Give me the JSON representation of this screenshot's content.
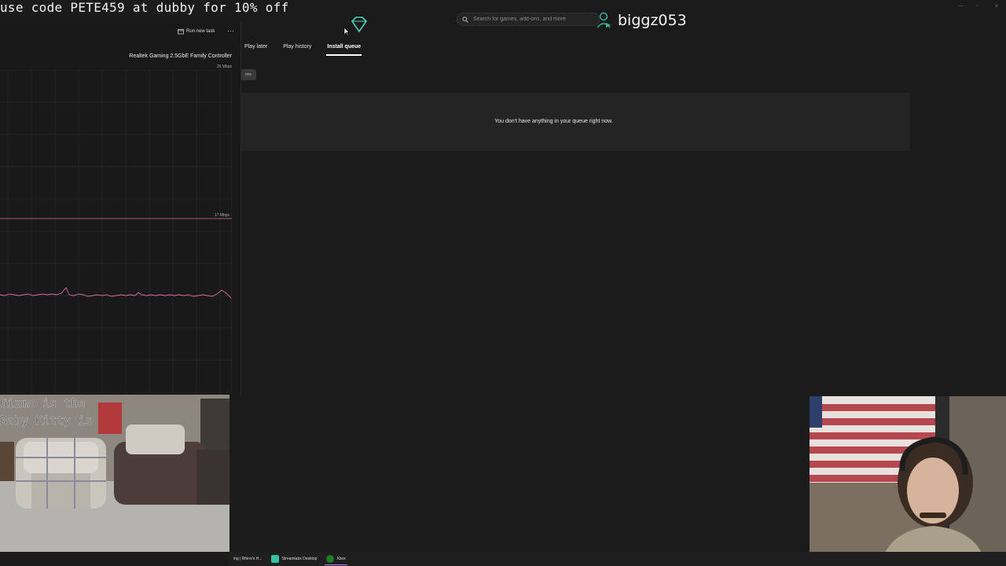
{
  "stream_overlay": {
    "promo_text": "use code PETE459 at dubby for 10% off",
    "room_cam_text": [
      "Gizmo is the",
      "Baby Kitty is"
    ]
  },
  "xbox": {
    "search": {
      "placeholder": "Search for games, add-ons, and more",
      "value": ""
    },
    "username": "biggz053",
    "tabs": [
      {
        "label": "Play later",
        "active": false
      },
      {
        "label": "Play history",
        "active": false
      },
      {
        "label": "Install queue",
        "active": true
      }
    ],
    "small_button_label": "ons",
    "queue_empty_message": "You don't have anything in your queue right now."
  },
  "task_manager": {
    "run_task_label": "Run new task",
    "more_label": "⋯",
    "adapter_name": "Realtek Gaming 2.5GbE Family Controller",
    "scale_top": "26 Mbps",
    "scale_mid": "17 Mbps",
    "graph_color": "#d96b9e"
  },
  "taskbar": {
    "items": [
      {
        "label": "ing | Rhino's H...",
        "icon": "browser-icon"
      },
      {
        "label": "Streamlabs Desktop",
        "icon": "streamlabs-icon"
      },
      {
        "label": "Xbox",
        "icon": "xbox-icon"
      }
    ]
  },
  "colors": {
    "background": "#1b1b1b",
    "panel": "#242424",
    "accent_teal": "#37b39a",
    "graph_pink": "#d96b9e"
  }
}
